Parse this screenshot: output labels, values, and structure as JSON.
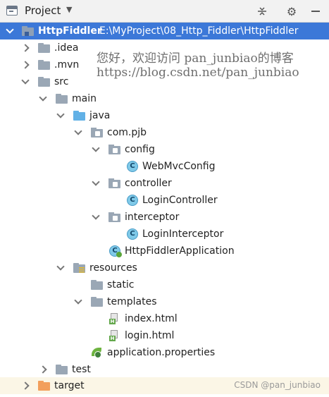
{
  "toolbar": {
    "title": "Project",
    "dropdown_icon": "caret-down",
    "icons": [
      "project-view-icon",
      "collapse-icon",
      "gear-icon",
      "hide-icon"
    ]
  },
  "tree": {
    "root": {
      "name": "HttpFiddler",
      "path": "E:\\MyProject\\08_Http_Fiddler\\HttpFiddler"
    },
    "idea": ".idea",
    "mvn": ".mvn",
    "src": "src",
    "main": "main",
    "java": "java",
    "package": "com.pjb",
    "config": "config",
    "webmvc": "WebMvcConfig",
    "controller": "controller",
    "login_controller": "LoginController",
    "interceptor": "interceptor",
    "login_interceptor": "LoginInterceptor",
    "app": "HttpFiddlerApplication",
    "resources": "resources",
    "static": "static",
    "templates": "templates",
    "index": "index.html",
    "login": "login.html",
    "props": "application.properties",
    "test": "test",
    "target": "target"
  },
  "badges": {
    "class": "C",
    "html": "H"
  },
  "watermark": {
    "line1": "您好，欢迎访问 pan_junbiao的博客",
    "line2": "https://blog.csdn.net/pan_junbiao"
  },
  "credit": "CSDN @pan_junbiao",
  "colors": {
    "selection": "#3c78d8",
    "folder": "#9aa7b5",
    "source_folder": "#62b1e6",
    "excluded_folder": "#f29f5c"
  }
}
